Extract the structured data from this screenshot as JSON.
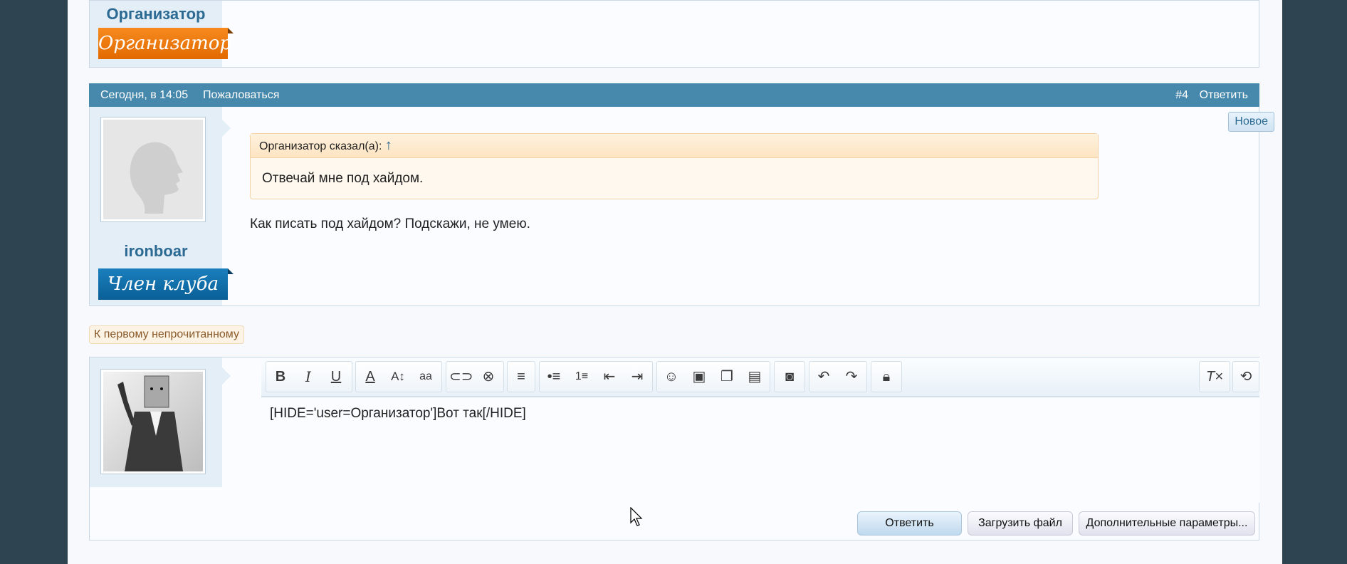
{
  "post_top": {
    "username": "Организатор",
    "rank": "Организатор"
  },
  "post": {
    "date": "Сегодня, в 14:05",
    "report": "Пожаловаться",
    "number": "#4",
    "reply": "Ответить",
    "new_badge": "Новое",
    "quote_author": "Организатор сказал(а):",
    "quote_arrow": "↑",
    "quote_text": "Отвечай мне под хайдом.",
    "message": "Как писать под хайдом? Подскажи, не умею.",
    "username": "ironboar",
    "rank": "Член клуба"
  },
  "first_unread": "К первому непрочитанному",
  "editor": {
    "content": "[HIDE='user=Организатор']Вот так[/HIDE]",
    "buttons": {
      "reply": "Ответить",
      "upload": "Загрузить файл",
      "more": "Дополнительные параметры..."
    }
  },
  "colors": {
    "accent": "#4789ad",
    "username": "#2c6a93",
    "background": "#2e4450"
  }
}
